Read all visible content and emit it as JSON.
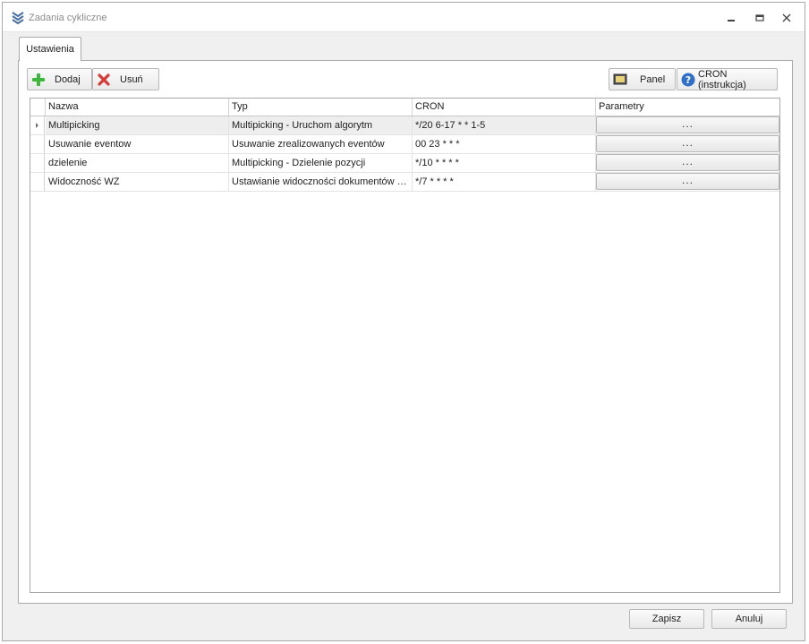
{
  "window": {
    "title": "Zadania cykliczne",
    "icons": {
      "app": "chevrons-down-icon",
      "minimize": "minimize-icon",
      "restore": "restore-icon",
      "close": "close-icon"
    }
  },
  "tabs": [
    {
      "label": "Ustawienia",
      "active": true
    }
  ],
  "toolbar": {
    "add_label": "Dodaj",
    "remove_label": "Usuń",
    "panel_label": "Panel",
    "cron_help_label": "CRON (instrukcja)"
  },
  "grid": {
    "columns": [
      "Nazwa",
      "Typ",
      "CRON",
      "Parametry"
    ],
    "rows": [
      {
        "name": "Multipicking",
        "type": "Multipicking - Uruchom algorytm",
        "cron": "*/20 6-17 * * 1-5",
        "params": "...",
        "selected": true
      },
      {
        "name": "Usuwanie eventow",
        "type": "Usuwanie zrealizowanych eventów",
        "cron": "00 23 * * *",
        "params": "..."
      },
      {
        "name": "dzielenie",
        "type": "Multipicking - Dzielenie pozycji",
        "cron": "*/10 * * * *",
        "params": "..."
      },
      {
        "name": "Widoczność WZ",
        "type": "Ustawianie widoczności dokumentów W...",
        "cron": "*/7 * * * *",
        "params": "..."
      }
    ]
  },
  "footer": {
    "save_label": "Zapisz",
    "cancel_label": "Anuluj"
  },
  "colors": {
    "add_green": "#3cb83c",
    "remove_red": "#d83a3a",
    "help_blue": "#2f6fc7",
    "selected_row": "#eeeeee"
  }
}
